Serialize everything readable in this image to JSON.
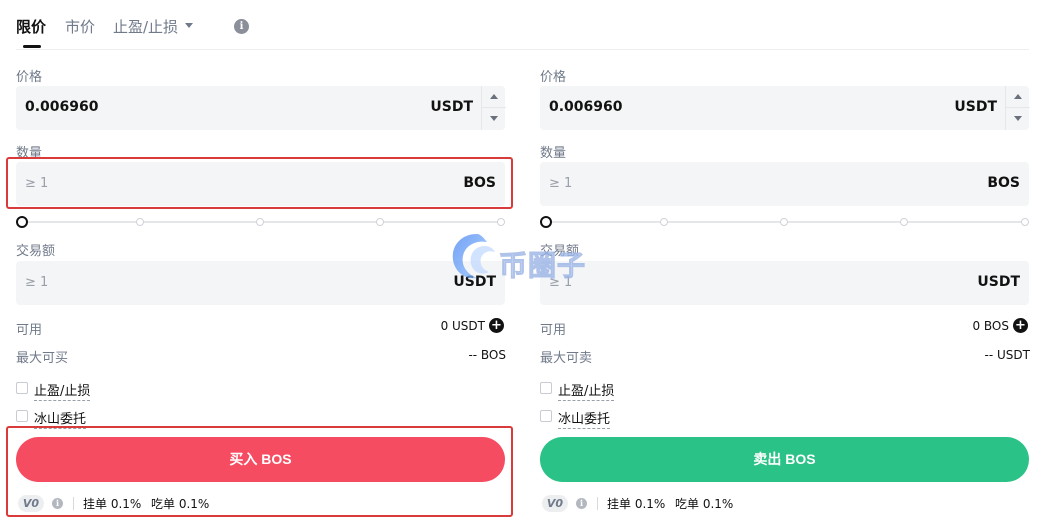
{
  "tabs": {
    "limit": "限价",
    "market": "市价",
    "stop": "止盈/止损"
  },
  "buy": {
    "price_label": "价格",
    "price_value": "0.006960",
    "price_unit": "USDT",
    "amount_label": "数量",
    "amount_placeholder": "≥ 1",
    "amount_unit": "BOS",
    "total_label": "交易额",
    "total_placeholder": "≥ 1",
    "total_unit": "USDT",
    "available_label": "可用",
    "available_value": "0 USDT",
    "max_label": "最大可买",
    "max_value": "-- BOS",
    "tpsl_label": "止盈/止损",
    "iceberg_label": "冰山委托",
    "action_label": "买入 BOS",
    "vip": "V0",
    "maker": "挂单 0.1%",
    "taker": "吃单 0.1%"
  },
  "sell": {
    "price_label": "价格",
    "price_value": "0.006960",
    "price_unit": "USDT",
    "amount_label": "数量",
    "amount_placeholder": "≥ 1",
    "amount_unit": "BOS",
    "total_label": "交易额",
    "total_placeholder": "≥ 1",
    "total_unit": "USDT",
    "available_label": "可用",
    "available_value": "0 BOS",
    "max_label": "最大可卖",
    "max_value": "-- USDT",
    "tpsl_label": "止盈/止损",
    "iceberg_label": "冰山委托",
    "action_label": "卖出 BOS",
    "vip": "V0",
    "maker": "挂单 0.1%",
    "taker": "吃单 0.1%"
  },
  "slider": {
    "buy_percent": 0,
    "sell_percent": 0
  },
  "watermark": {
    "text": "币圈子"
  },
  "colors": {
    "buy": "#f64c61",
    "sell": "#2bc287",
    "highlight": "#d93a3a"
  }
}
